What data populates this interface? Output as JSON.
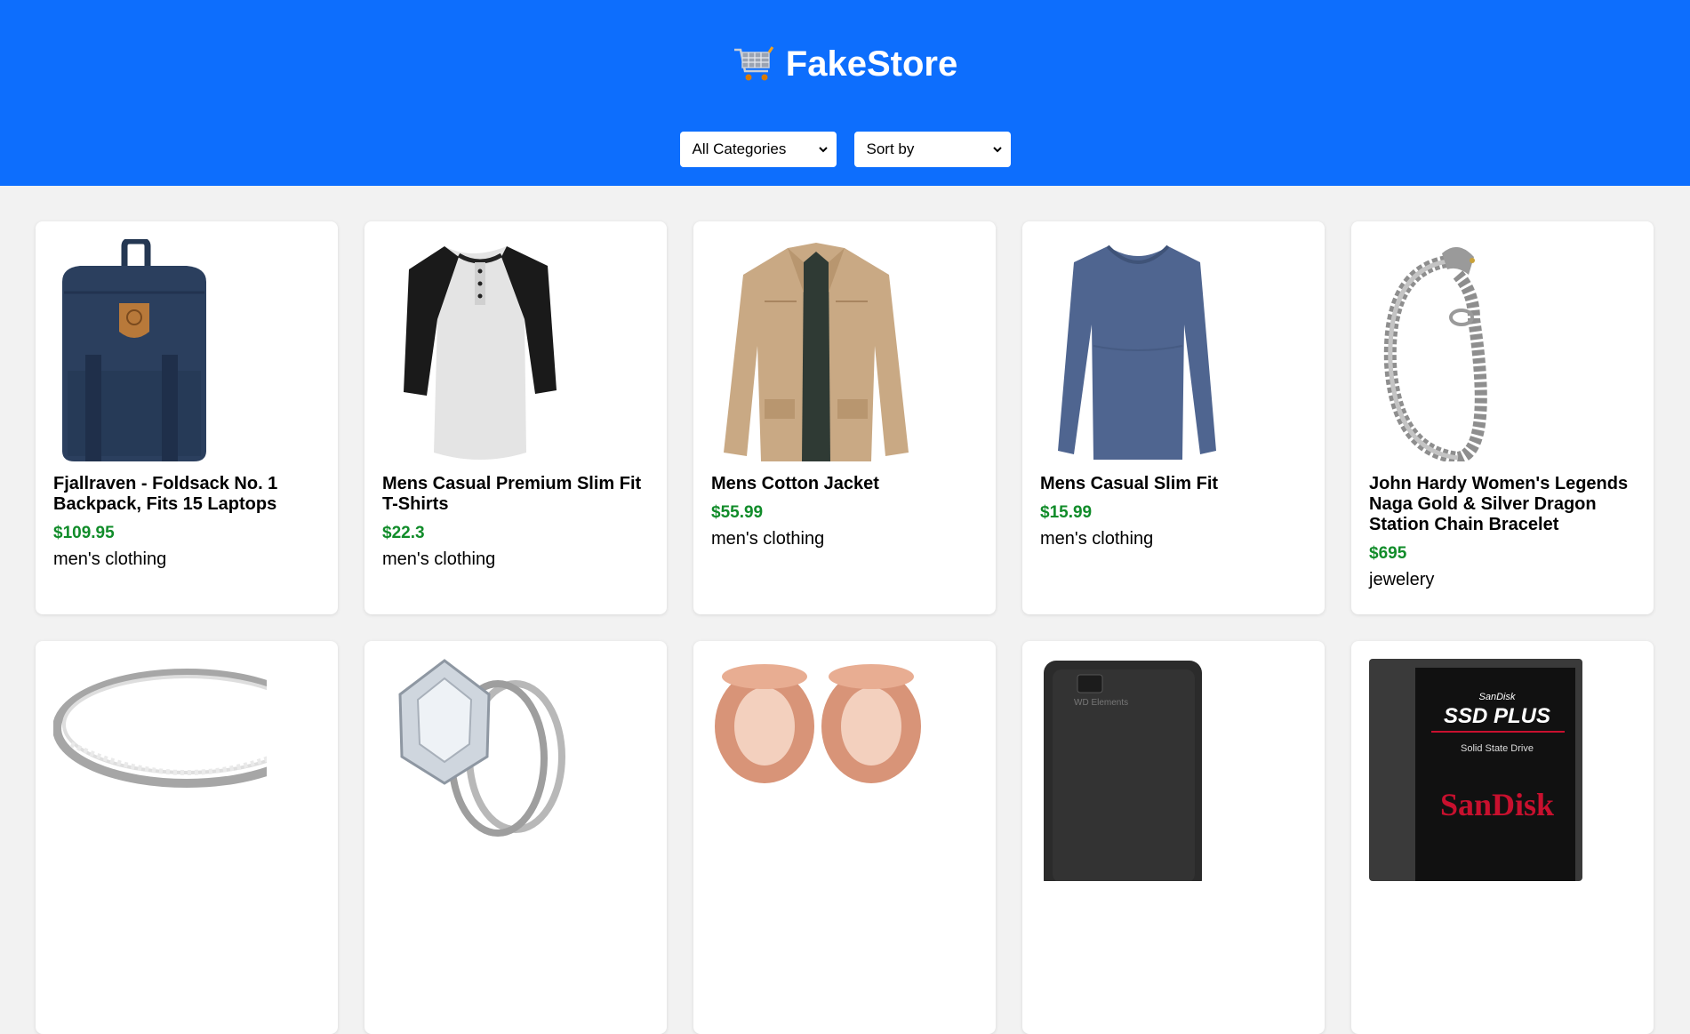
{
  "store": {
    "title": "FakeStore",
    "icon": "shopping-cart-icon"
  },
  "filters": {
    "category_value": "All Categories",
    "sort_value": "Sort by"
  },
  "colors": {
    "header_bg": "#0d6efd",
    "price": "#118c2a",
    "page_bg": "#f2f2f2"
  },
  "products": [
    {
      "name": "Fjallraven - Foldsack No. 1 Backpack, Fits 15 Laptops",
      "price": "$109.95",
      "category": "men's clothing",
      "image": "backpack-image"
    },
    {
      "name": "Mens Casual Premium Slim Fit T-Shirts",
      "price": "$22.3",
      "category": "men's clothing",
      "image": "raglan-tshirt-image"
    },
    {
      "name": "Mens Cotton Jacket",
      "price": "$55.99",
      "category": "men's clothing",
      "image": "cotton-jacket-image"
    },
    {
      "name": "Mens Casual Slim Fit",
      "price": "$15.99",
      "category": "men's clothing",
      "image": "longsleeve-shirt-image"
    },
    {
      "name": "John Hardy Women's Legends Naga Gold & Silver Dragon Station Chain Bracelet",
      "price": "$695",
      "category": "jewelery",
      "image": "dragon-bracelet-image"
    },
    {
      "name": "",
      "price": "",
      "category": "",
      "image": "silver-ring-image"
    },
    {
      "name": "",
      "price": "",
      "category": "",
      "image": "diamond-ring-image"
    },
    {
      "name": "",
      "price": "",
      "category": "",
      "image": "rose-gold-plugs-image"
    },
    {
      "name": "",
      "price": "",
      "category": "",
      "image": "external-hard-drive-image"
    },
    {
      "name": "",
      "price": "",
      "category": "",
      "image": "ssd-drive-image"
    }
  ],
  "product_image_text": {
    "wd_brand": "WD Elements",
    "ssd_brand": "SanDisk",
    "ssd_model": "SSD PLUS",
    "ssd_desc": "Solid State Drive",
    "ssd_logo": "SanDisk"
  }
}
